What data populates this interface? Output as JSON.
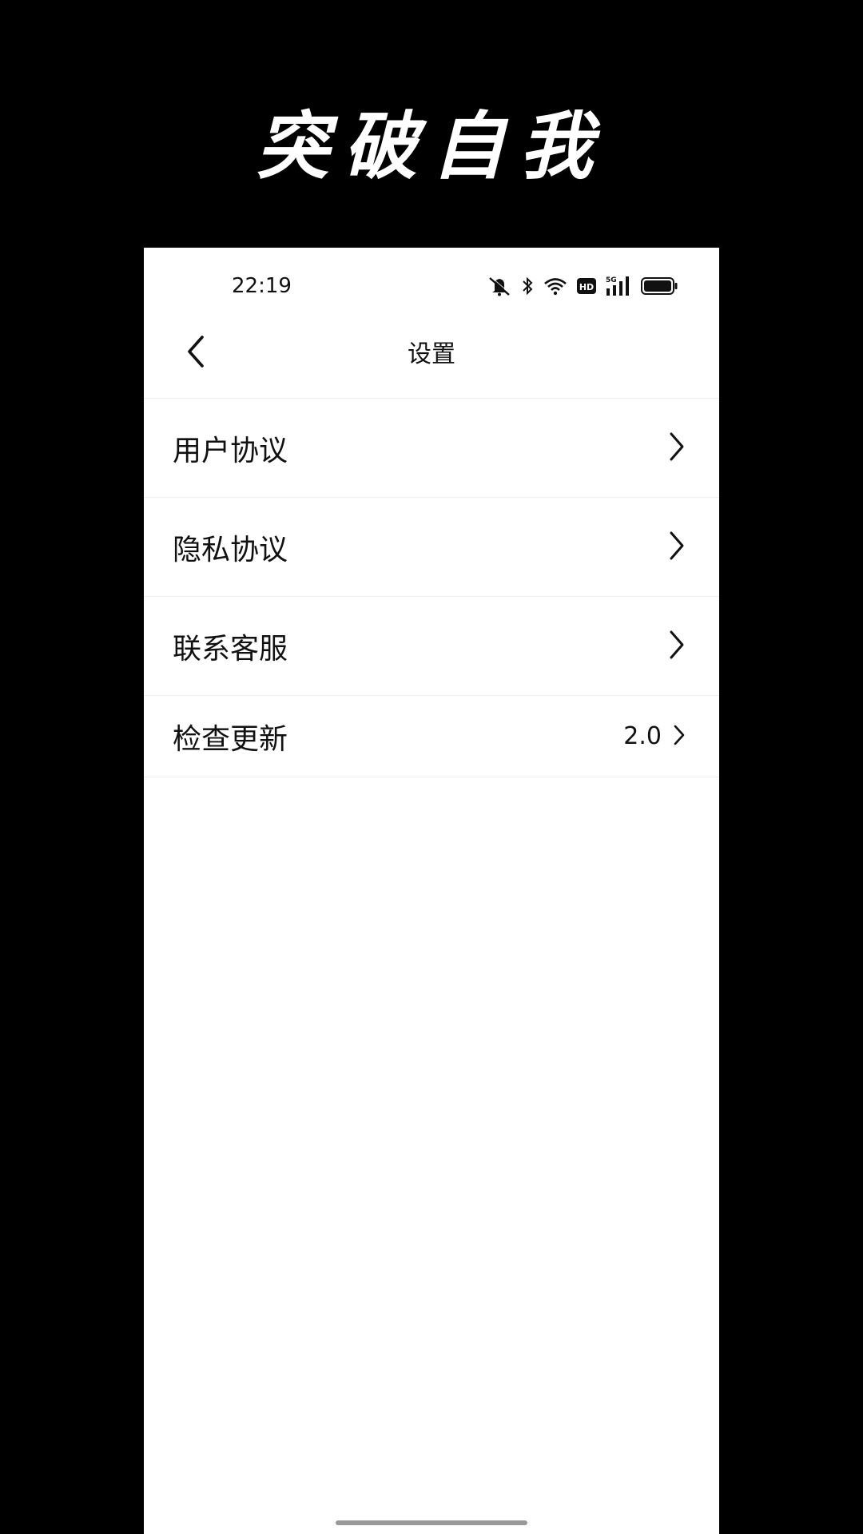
{
  "banner": {
    "text": "突破自我"
  },
  "status_bar": {
    "time": "22:19",
    "icons": [
      "mute-bell-icon",
      "bluetooth-icon",
      "wifi-icon",
      "hd-icon",
      "5g-signal-icon",
      "battery-icon"
    ],
    "network_label": "5G",
    "hd_label": "HD"
  },
  "nav": {
    "title": "设置",
    "back_icon": "chevron-left-icon"
  },
  "menu": {
    "items": [
      {
        "label": "用户协议",
        "value": "",
        "icon": "chevron-right-icon"
      },
      {
        "label": "隐私协议",
        "value": "",
        "icon": "chevron-right-icon"
      },
      {
        "label": "联系客服",
        "value": "",
        "icon": "chevron-right-icon"
      },
      {
        "label": "检查更新",
        "value": "2.0",
        "icon": "chevron-right-icon"
      }
    ]
  },
  "colors": {
    "outer_background": "#000000",
    "screen_background": "#ffffff",
    "text": "#111111",
    "divider": "#eeeeee",
    "home_indicator": "#999999"
  }
}
